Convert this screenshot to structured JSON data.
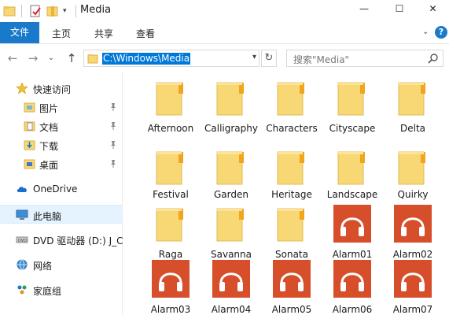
{
  "window": {
    "title": "Media",
    "minimize_glyph": "—",
    "maximize_glyph": "☐",
    "close_glyph": "✕"
  },
  "ribbon": {
    "tabs": [
      "文件",
      "主页",
      "共享",
      "查看"
    ],
    "help_glyph": "?"
  },
  "address": {
    "path": "C:\\Windows\\Media",
    "search_placeholder": "搜索\"Media\""
  },
  "sidebar": {
    "items": [
      {
        "label": "快速访问",
        "icon": "star-icon"
      },
      {
        "label": "图片",
        "icon": "pictures-icon",
        "pinned": true
      },
      {
        "label": "文档",
        "icon": "documents-icon",
        "pinned": true
      },
      {
        "label": "下载",
        "icon": "download-icon",
        "pinned": true
      },
      {
        "label": "桌面",
        "icon": "desktop-icon",
        "pinned": true
      },
      {
        "label": "OneDrive",
        "icon": "cloud-icon"
      },
      {
        "label": "此电脑",
        "icon": "computer-icon",
        "selected": true
      },
      {
        "label": "DVD 驱动器 (D:) J_C",
        "icon": "dvd-icon"
      },
      {
        "label": "网络",
        "icon": "network-icon"
      },
      {
        "label": "家庭组",
        "icon": "homegroup-icon"
      }
    ]
  },
  "files": [
    {
      "name": "Afternoon",
      "type": "folder"
    },
    {
      "name": "Calligraphy",
      "type": "folder"
    },
    {
      "name": "Characters",
      "type": "folder"
    },
    {
      "name": "Cityscape",
      "type": "folder"
    },
    {
      "name": "Delta",
      "type": "folder"
    },
    {
      "name": "Festival",
      "type": "folder"
    },
    {
      "name": "Garden",
      "type": "folder"
    },
    {
      "name": "Heritage",
      "type": "folder"
    },
    {
      "name": "Landscape",
      "type": "folder"
    },
    {
      "name": "Quirky",
      "type": "folder"
    },
    {
      "name": "Raga",
      "type": "folder"
    },
    {
      "name": "Savanna",
      "type": "folder"
    },
    {
      "name": "Sonata",
      "type": "folder"
    },
    {
      "name": "Alarm01",
      "type": "audio"
    },
    {
      "name": "Alarm02",
      "type": "audio"
    },
    {
      "name": "Alarm03",
      "type": "audio"
    },
    {
      "name": "Alarm04",
      "type": "audio"
    },
    {
      "name": "Alarm05",
      "type": "audio"
    },
    {
      "name": "Alarm06",
      "type": "audio"
    },
    {
      "name": "Alarm07",
      "type": "audio"
    }
  ],
  "colors": {
    "file_tab": "#1979ca",
    "folder": "#f8d775",
    "audio_tile": "#d64e2a",
    "selection": "#0078d7"
  }
}
